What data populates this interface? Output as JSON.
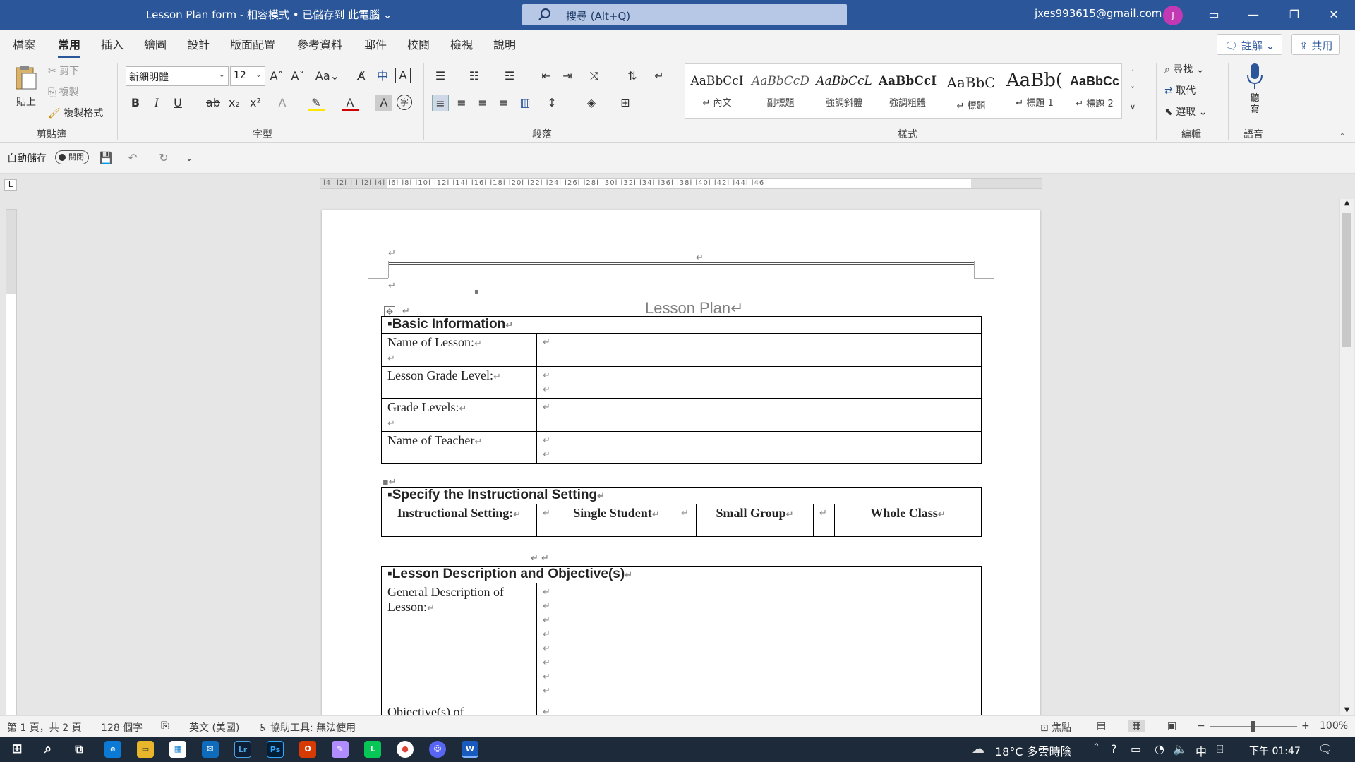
{
  "titlebar": {
    "doc_title": "Lesson Plan form  -  相容模式 • 已儲存到 此電腦  ⌄",
    "search_placeholder": "搜尋 (Alt+Q)",
    "account": "jxes993615@gmail.com",
    "avatar_initial": "J"
  },
  "tabs": [
    "檔案",
    "常用",
    "插入",
    "繪圖",
    "設計",
    "版面配置",
    "參考資料",
    "郵件",
    "校閱",
    "檢視",
    "說明"
  ],
  "comment_button": "註解",
  "share_button": "共用",
  "clipboard": {
    "paste": "貼上",
    "cut": "剪下",
    "copy": "複製",
    "format_painter": "複製格式",
    "label": "剪貼簿"
  },
  "font": {
    "name": "新細明體",
    "size": "12",
    "label": "字型"
  },
  "paragraph": {
    "label": "段落"
  },
  "styles": {
    "label": "樣式",
    "items": [
      {
        "preview": "AaBbCcI",
        "name": "↵ 內文"
      },
      {
        "preview": "AaBbCcD",
        "name": "副標題"
      },
      {
        "preview": "AaBbCcL",
        "name": "強調斜體"
      },
      {
        "preview": "AaBbCcI",
        "name": "強調粗體"
      },
      {
        "preview": "AaBbC",
        "name": "↵ 標題"
      },
      {
        "preview": "AaBb(",
        "name": "↵ 標題 1"
      },
      {
        "preview": "AaBbCc",
        "name": "↵ 標題 2"
      }
    ]
  },
  "editing": {
    "find": "尋找",
    "replace": "取代",
    "select": "選取",
    "label": "編輯"
  },
  "voice": {
    "dictate": "聽寫",
    "label": "語音"
  },
  "qat": {
    "autosave": "自動儲存",
    "toggle": "關閉"
  },
  "ruler": {
    "horizontal": "l4l  l2l  l  l  l2l  l4l  l6l  l8l  l10l  l12l  l14l  l16l  l18l  l20l  l22l  l24l  l26l  l28l  l30l  l32l  l34l  l36l  l38l  l40l  l42l  l44l  l46"
  },
  "document": {
    "heading": "Lesson Plan↵",
    "basic": {
      "title": "Basic Information",
      "rows": [
        {
          "label": "Name of Lesson:"
        },
        {
          "label": "Lesson Grade Level:"
        },
        {
          "label": "Grade Levels:"
        },
        {
          "label": "Name of Teacher"
        }
      ]
    },
    "setting": {
      "title": "Specify the Instructional Setting",
      "label": "Instructional Setting:",
      "options": [
        "Single Student",
        "Small Group",
        "Whole Class"
      ]
    },
    "description": {
      "title": "Lesson Description and Objective(s)",
      "general": "General Description of Lesson:",
      "objectives": "Objective(s) of"
    }
  },
  "status": {
    "page": "第 1 頁，共 2 頁",
    "words": "128 個字",
    "language": "英文 (美國)",
    "accessibility": "協助工具: 無法使用",
    "focus": "焦點",
    "zoom": "100%"
  },
  "taskbar": {
    "weather": "18°C  多雲時陰",
    "ime": "中",
    "time": "下午 01:47"
  }
}
